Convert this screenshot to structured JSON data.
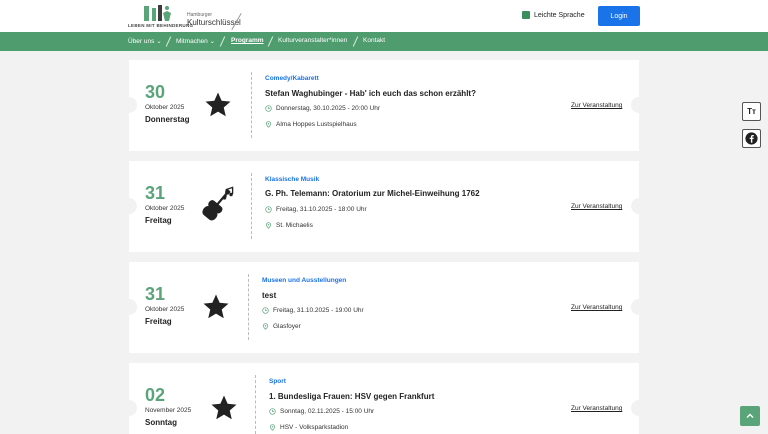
{
  "header": {
    "logo_caption": "LEBEN MIT BEHINDERUNG",
    "brand_small": "Hamburger",
    "brand_big": "Kulturschlüssel",
    "easy_language": "Leichte Sprache",
    "login": "Login"
  },
  "nav": {
    "items": [
      {
        "label": "Über uns",
        "dropdown": true
      },
      {
        "label": "Mitmachen",
        "dropdown": true
      },
      {
        "label": "Programm",
        "active": true
      },
      {
        "label": "Kulturveranstalter*innen"
      },
      {
        "label": "Kontakt"
      }
    ]
  },
  "events": [
    {
      "day": "30",
      "month": "Oktober 2025",
      "weekday": "Donnerstag",
      "icon": "star-icon",
      "category": "Comedy/Kabarett",
      "title": "Stefan Waghubinger - Hab' ich euch das schon erzählt?",
      "datetime": "Donnerstag, 30.10.2025 - 20:00 Uhr",
      "location": "Alma Hoppes Lustspielhaus",
      "link": "Zur Veranstaltung"
    },
    {
      "day": "31",
      "month": "Oktober 2025",
      "weekday": "Freitag",
      "icon": "violin-icon",
      "category": "Klassische Musik",
      "title": "G. Ph. Telemann: Oratorium zur Michel-Einweihung 1762",
      "datetime": "Freitag, 31.10.2025 - 18:00 Uhr",
      "location": "St. Michaelis",
      "link": "Zur Veranstaltung"
    },
    {
      "day": "31",
      "month": "Oktober 2025",
      "weekday": "Freitag",
      "icon": "star-icon",
      "category": "Museen und Ausstellungen",
      "title": "test",
      "datetime": "Freitag, 31.10.2025 - 19:00 Uhr",
      "location": "Glasfoyer",
      "link": "Zur Veranstaltung"
    },
    {
      "day": "02",
      "month": "November 2025",
      "weekday": "Sonntag",
      "icon": "star-icon",
      "category": "Sport",
      "title": "1. Bundesliga Frauen: HSV gegen Frankfurt",
      "datetime": "Sonntag, 02.11.2025 - 15:00 Uhr",
      "location": "HSV - Volksparkstadion",
      "link": "Zur Veranstaltung"
    }
  ],
  "widgets": {
    "font_size_label": "Tт"
  },
  "colors": {
    "green": "#4f9c6e",
    "accent_blue": "#1a73e8"
  }
}
